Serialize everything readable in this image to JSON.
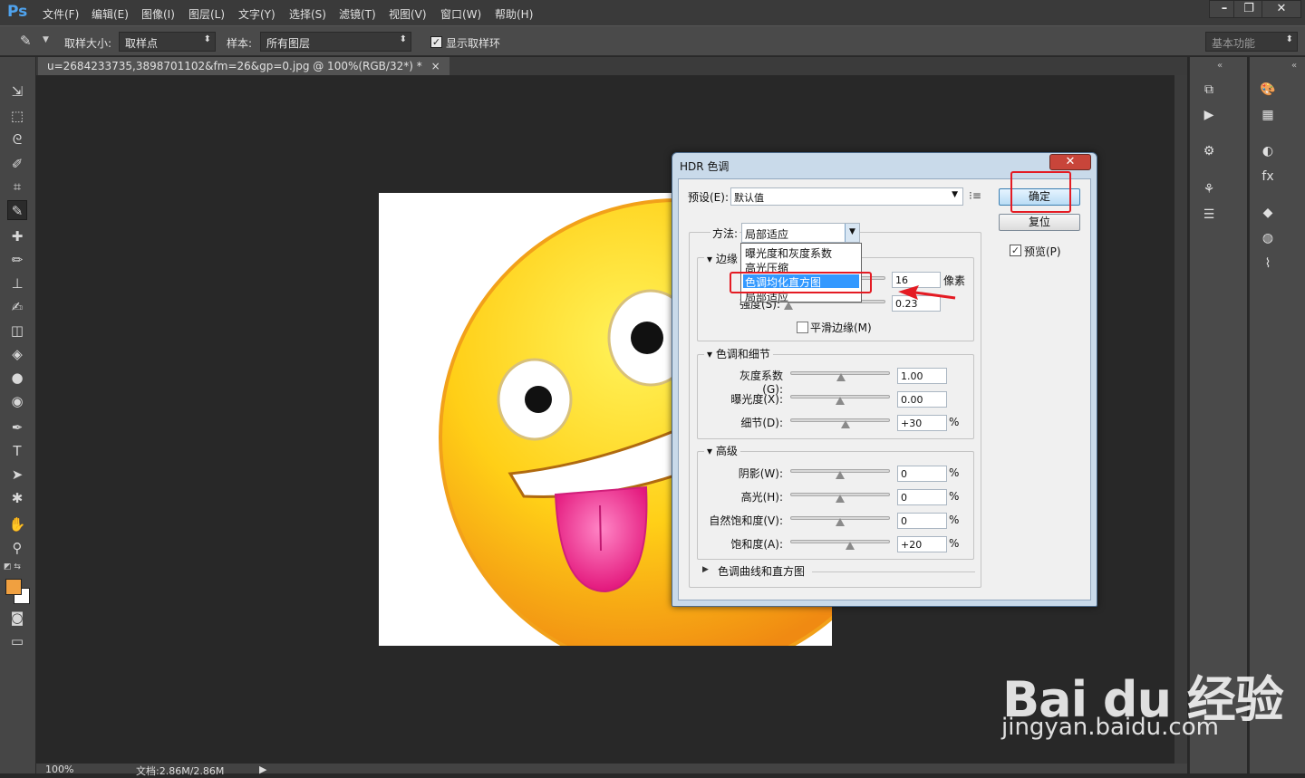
{
  "app": {
    "logo": "Ps",
    "menu": [
      "文件(F)",
      "编辑(E)",
      "图像(I)",
      "图层(L)",
      "文字(Y)",
      "选择(S)",
      "滤镜(T)",
      "视图(V)",
      "窗口(W)",
      "帮助(H)"
    ],
    "window_buttons": [
      "–",
      "❐",
      "✕"
    ]
  },
  "options": {
    "sample_size_label": "取样大小:",
    "sample_size_value": "取样点",
    "sample_label": "样本:",
    "sample_value": "所有图层",
    "show_ring_label": "显示取样环",
    "show_ring_checked": true,
    "workspace": "基本功能"
  },
  "document": {
    "tab_title": "u=2684233735,3898701102&fm=26&gp=0.jpg @ 100%(RGB/32*) *",
    "tab_close": "×"
  },
  "status": {
    "zoom": "100%",
    "doc_info": "文档:2.86M/2.86M"
  },
  "dialog": {
    "title": "HDR 色调",
    "close": "✕",
    "preset_label": "预设(E):",
    "preset_value": "默认值",
    "ok": "确定",
    "reset": "复位",
    "preview_label": "预览(P)",
    "preview_checked": true,
    "method_label": "方法:",
    "method_value": "局部适应",
    "method_options": [
      "曝光度和灰度系数",
      "高光压缩",
      "色调均化直方图",
      "局部适应"
    ],
    "method_selected_index": 2,
    "edge_glow": {
      "title": "边缘",
      "radius_value": "16",
      "radius_unit": "像素",
      "strength_label": "强度(S):",
      "strength_value": "0.23",
      "smooth_label": "平滑边缘(M)",
      "smooth_checked": false
    },
    "tone_detail": {
      "title": "色调和细节",
      "rows": [
        {
          "label": "灰度系数(G):",
          "value": "1.00",
          "unit": ""
        },
        {
          "label": "曝光度(X):",
          "value": "0.00",
          "unit": ""
        },
        {
          "label": "细节(D):",
          "value": "+30",
          "unit": "%"
        }
      ]
    },
    "advanced": {
      "title": "高级",
      "rows": [
        {
          "label": "阴影(W):",
          "value": "0",
          "unit": "%"
        },
        {
          "label": "高光(H):",
          "value": "0",
          "unit": "%"
        },
        {
          "label": "自然饱和度(V):",
          "value": "0",
          "unit": "%"
        },
        {
          "label": "饱和度(A):",
          "value": "+20",
          "unit": "%"
        }
      ]
    },
    "curve_section": "色调曲线和直方图"
  },
  "watermark": {
    "brand": "Bai du 经验",
    "url": "jingyan.baidu.com"
  },
  "colors": {
    "accent": "#3399ff",
    "highlight": "#e41b23",
    "foreground_swatch": "#f0a040",
    "background_swatch": "#ffffff"
  }
}
